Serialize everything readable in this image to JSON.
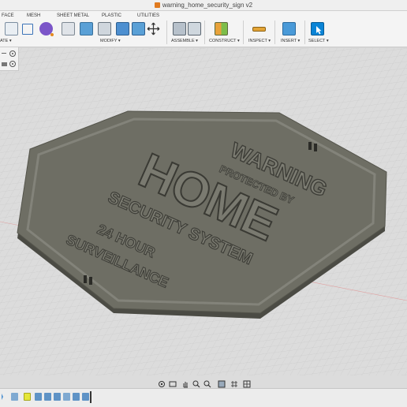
{
  "window": {
    "document_title": "warning_home_security_sign v2"
  },
  "toolbar": {
    "tabs": [
      "FACE",
      "MESH",
      "SHEET METAL",
      "PLASTIC",
      "UTILITIES"
    ],
    "groups": [
      "ATE ▾",
      "MODIFY ▾",
      "ASSEMBLE ▾",
      "CONSTRUCT ▾",
      "INSPECT ▾",
      "INSERT ▾",
      "SELECT ▾"
    ]
  },
  "model": {
    "heading": "WARNING",
    "subheading": "PROTECTED BY",
    "main": "HOME",
    "system": "SECURITY SYSTEM",
    "hours": "24 HOUR",
    "surveillance": "SURVEILLANCE"
  },
  "colors": {
    "accent": "#0a84d6",
    "sign_face": "#6c6c62",
    "sign_edge": "#4a4a43"
  }
}
